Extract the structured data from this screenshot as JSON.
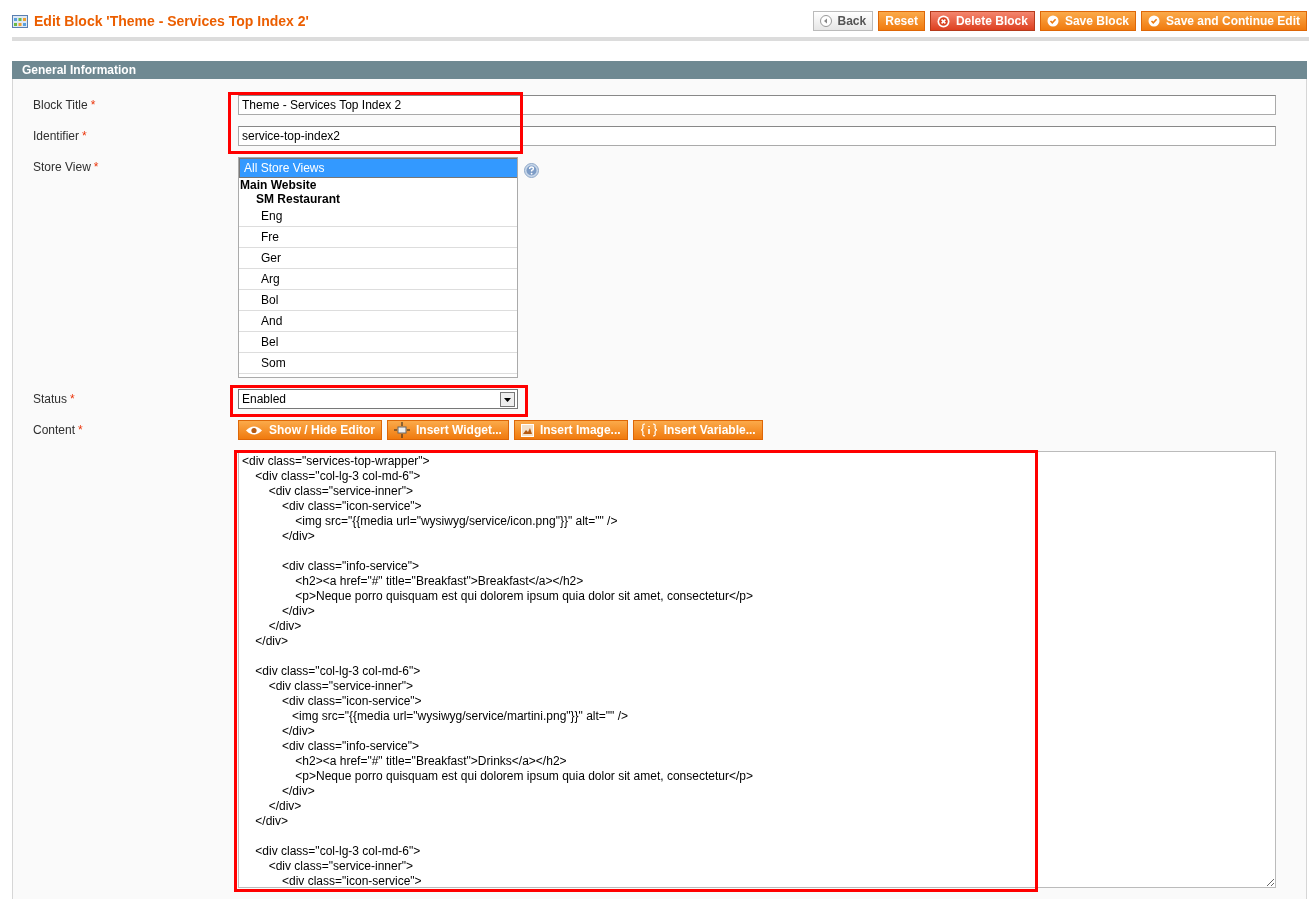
{
  "page": {
    "title": "Edit Block 'Theme - Services Top Index 2'"
  },
  "actions": [
    {
      "label": "Back",
      "kind": "back"
    },
    {
      "label": "Reset",
      "kind": "reset"
    },
    {
      "label": "Delete Block",
      "kind": "delete"
    },
    {
      "label": "Save Block",
      "kind": "save"
    },
    {
      "label": "Save and Continue Edit",
      "kind": "save"
    }
  ],
  "section": {
    "title": "General Information"
  },
  "fields": {
    "block_title": {
      "label": "Block Title",
      "required_mark": "*",
      "value": "Theme - Services Top Index 2"
    },
    "identifier": {
      "label": "Identifier",
      "required_mark": "*",
      "value": "service-top-index2"
    },
    "store_view": {
      "label": "Store View",
      "required_mark": "*",
      "options": [
        {
          "label": "All Store Views",
          "selected": true
        },
        {
          "label": "Main Website",
          "children": [
            {
              "label": "SM Restaurant",
              "children": [
                {
                  "label": "Eng",
                  "selected": false
                },
                {
                  "label": "Fre",
                  "selected": false
                },
                {
                  "label": "Ger",
                  "selected": false
                },
                {
                  "label": "Arg",
                  "selected": false
                },
                {
                  "label": "Bol",
                  "selected": false
                },
                {
                  "label": "And",
                  "selected": false
                },
                {
                  "label": "Bel",
                  "selected": false
                },
                {
                  "label": "Som",
                  "selected": false
                }
              ]
            }
          ]
        }
      ]
    },
    "status": {
      "label": "Status",
      "required_mark": "*",
      "value": "Enabled"
    },
    "content": {
      "label": "Content",
      "required_mark": "*",
      "editor_buttons": [
        {
          "label": "Show / Hide Editor",
          "kind": "toggle"
        },
        {
          "label": "Insert Widget...",
          "kind": "widget"
        },
        {
          "label": "Insert Image...",
          "kind": "image"
        },
        {
          "label": "Insert Variable...",
          "kind": "variable"
        }
      ],
      "value": "<div class=\"services-top-wrapper\">\n    <div class=\"col-lg-3 col-md-6\">\n        <div class=\"service-inner\">\n            <div class=\"icon-service\">\n                <img src=\"{{media url=\"wysiwyg/service/icon.png\"}}\" alt=\"\" />\n            </div>\n\n            <div class=\"info-service\">\n                <h2><a href=\"#\" title=\"Breakfast\">Breakfast</a></h2>\n                <p>Neque porro quisquam est qui dolorem ipsum quia dolor sit amet, consectetur</p>\n            </div>\n        </div>\n    </div>\n\n    <div class=\"col-lg-3 col-md-6\">\n        <div class=\"service-inner\">\n            <div class=\"icon-service\">\n               <img src=\"{{media url=\"wysiwyg/service/martini.png\"}}\" alt=\"\" />\n            </div>\n            <div class=\"info-service\">\n                <h2><a href=\"#\" title=\"Breakfast\">Drinks</a></h2>\n                <p>Neque porro quisquam est qui dolorem ipsum quia dolor sit amet, consectetur</p>\n            </div>\n        </div>\n    </div>\n\n    <div class=\"col-lg-3 col-md-6\">\n        <div class=\"service-inner\">\n            <div class=\"icon-service\">"
    }
  }
}
